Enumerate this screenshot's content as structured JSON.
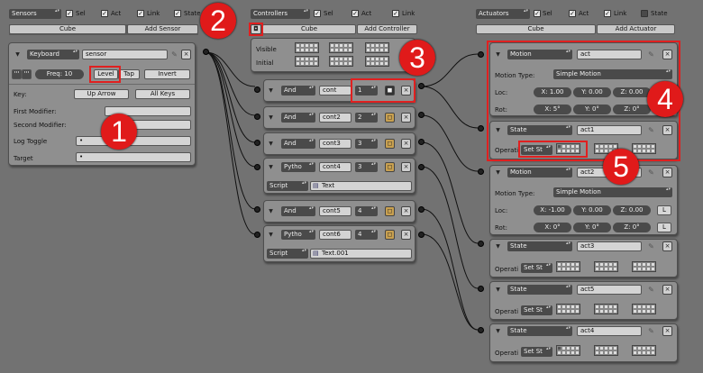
{
  "sensors": {
    "header": "Sensors",
    "sel": "Sel",
    "act": "Act",
    "link": "Link",
    "state": "State",
    "object": "Cube",
    "add": "Add Sensor",
    "type": "Keyboard",
    "name": "sensor",
    "freq": "Freq: 10",
    "level": "Level",
    "tap": "Tap",
    "invert": "Invert",
    "key_label": "Key:",
    "key_value": "Up Arrow",
    "all_keys": "All Keys",
    "first_mod": "First Modifier:",
    "second_mod": "Second Modifier:",
    "log_toggle": "Log Toggle",
    "target": "Target",
    "dot": "•",
    "pulse1": "'''",
    "pulse2": "'''"
  },
  "controllers": {
    "header": "Controllers",
    "sel": "Sel",
    "act": "Act",
    "link": "Link",
    "object": "Cube",
    "add": "Add Controller",
    "visible": "Visible",
    "initial": "Initial",
    "items": [
      {
        "type": "And",
        "name": "cont",
        "num": "1"
      },
      {
        "type": "And",
        "name": "cont2",
        "num": "2"
      },
      {
        "type": "And",
        "name": "cont3",
        "num": "3"
      },
      {
        "type": "Pytho",
        "name": "cont4",
        "num": "3",
        "mode": "Script",
        "text": "Text"
      },
      {
        "type": "And",
        "name": "cont5",
        "num": "4"
      },
      {
        "type": "Pytho",
        "name": "cont6",
        "num": "4",
        "mode": "Script",
        "text": "Text.001"
      }
    ]
  },
  "actuators": {
    "header": "Actuators",
    "sel": "Sel",
    "act": "Act",
    "link": "Link",
    "state": "State",
    "object": "Cube",
    "add": "Add Actuator",
    "motion1": {
      "type": "Motion",
      "name": "act",
      "motion_type_label": "Motion Type:",
      "motion_type": "Simple Motion",
      "loc_label": "Loc:",
      "loc": [
        "X: 1.00",
        "Y: 0.00",
        "Z: 0.00"
      ],
      "rot_label": "Rot:",
      "rot": [
        "X: 5°",
        "Y: 0°",
        "Z: 0°"
      ],
      "L": "L"
    },
    "state1": {
      "type": "State",
      "name": "act1",
      "op_label": "Operati",
      "op": "Set St"
    },
    "motion2": {
      "type": "Motion",
      "name": "act2",
      "motion_type_label": "Motion Type:",
      "motion_type": "Simple Motion",
      "loc_label": "Loc:",
      "loc": [
        "X: -1.00",
        "Y: 0.00",
        "Z: 0.00"
      ],
      "rot_label": "Rot:",
      "rot": [
        "X: 0°",
        "Y: 0°",
        "Z: 0°"
      ],
      "L": "L"
    },
    "state3": {
      "type": "State",
      "name": "act3",
      "op_label": "Operati",
      "op": "Set St"
    },
    "state5": {
      "type": "State",
      "name": "act5",
      "op_label": "Operati",
      "op": "Set St"
    },
    "state4": {
      "type": "State",
      "name": "act4",
      "op_label": "Operati",
      "op": "Set St"
    }
  },
  "badges": [
    "1",
    "2",
    "3",
    "4",
    "5"
  ]
}
